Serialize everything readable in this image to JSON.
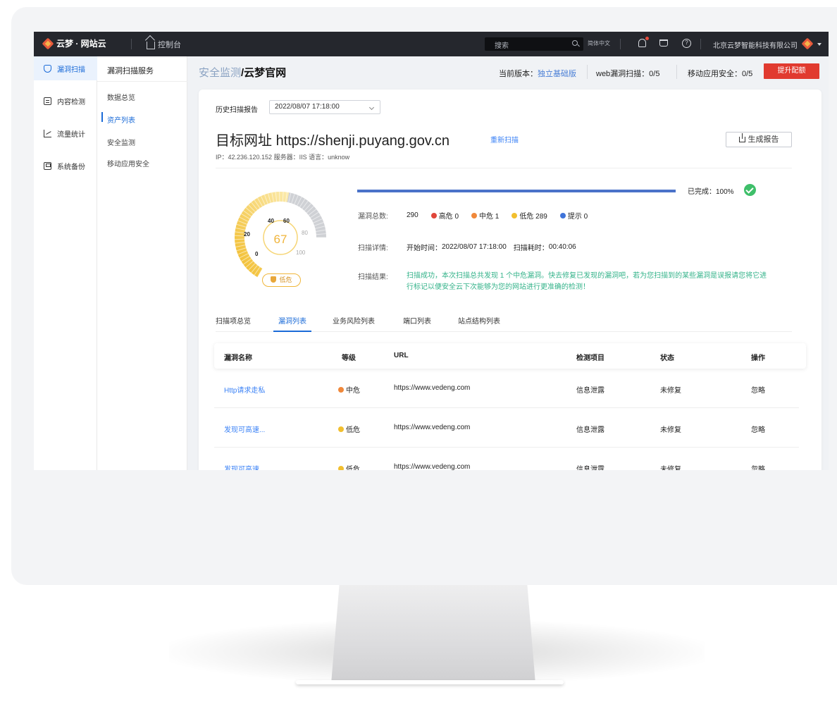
{
  "brand": {
    "name": "云梦 · 网站云"
  },
  "topbar": {
    "console": "控制台",
    "search_placeholder": "搜索",
    "lang": "简体中文",
    "company": "北京云梦智能科技有限公司"
  },
  "rail": {
    "items": [
      {
        "label": "漏洞扫描",
        "active": true
      },
      {
        "label": "内容检测"
      },
      {
        "label": "流量统计"
      },
      {
        "label": "系统备份"
      }
    ]
  },
  "submenu": {
    "title": "漏洞扫描服务",
    "items": [
      {
        "label": "数据总览"
      },
      {
        "label": "资产列表",
        "active": true
      },
      {
        "label": "安全监测"
      },
      {
        "label": "移动应用安全"
      }
    ]
  },
  "header": {
    "crumb_parent": "安全监测",
    "crumb_current": "/云梦官网",
    "version_label": "当前版本：",
    "version_value": "独立基础版",
    "webscan": "web漏洞扫描：0/5",
    "mobile": "移动应用安全：0/5",
    "upgrade": "提升配额"
  },
  "report": {
    "history_label": "历史扫描报告",
    "history_value": "2022/08/07 17:18:00",
    "target_label": "目标网址",
    "target_url": "https://shenji.puyang.gov.cn",
    "rescan": "重新扫描",
    "generate": "生成报告",
    "meta": "IP：42.236.120.152    服务器：IIS    语言：unknow"
  },
  "gauge": {
    "score": "67",
    "score_value": 67,
    "ticks": [
      "0",
      "20",
      "40",
      "60",
      "80",
      "100"
    ],
    "risk": "低危"
  },
  "scan": {
    "progress_value": 100,
    "progress_text": "已完成：100%",
    "total_label": "漏洞总数:",
    "total": "290",
    "high": "高危 0",
    "medium": "中危 1",
    "low": "低危 289",
    "info": "提示 0",
    "detail_label": "扫描详情:",
    "start_label": "开始时间：",
    "start_time": "2022/08/07 17:18:00",
    "duration_label": "扫描耗时：",
    "duration": "00:40:06",
    "result_label": "扫描结果:",
    "result_text": "扫描成功，本次扫描总共发现 1 个中危漏洞。快去修复已发现的漏洞吧，若为您扫描到的某些漏洞是误报请您将它进行标记以便安全云下次能够为您的网站进行更准确的检测！"
  },
  "colors": {
    "high": "#e0463a",
    "medium": "#f0883a",
    "low": "#f2bf2e",
    "info": "#3f73d9",
    "accent": "#1b6bd8"
  },
  "tabs": [
    "扫描项总览",
    "漏洞列表",
    "业务风险列表",
    "端口列表",
    "站点结构列表"
  ],
  "table": {
    "headers": [
      "漏洞名称",
      "等级",
      "URL",
      "检测项目",
      "状态",
      "操作"
    ],
    "rows": [
      {
        "name": "Http请求走私",
        "level": "中危",
        "url": "https://www.vedeng.com",
        "item": "信息泄露",
        "status": "未修复",
        "action": "忽略"
      },
      {
        "name": "发现可高速...",
        "level": "低危",
        "url": "https://www.vedeng.com",
        "item": "信息泄露",
        "status": "未修复",
        "action": "忽略"
      },
      {
        "name": "发现可高速...",
        "level": "低危",
        "url": "https://www.vedeng.com",
        "item": "信息泄露",
        "status": "未修复",
        "action": "忽略"
      }
    ]
  }
}
